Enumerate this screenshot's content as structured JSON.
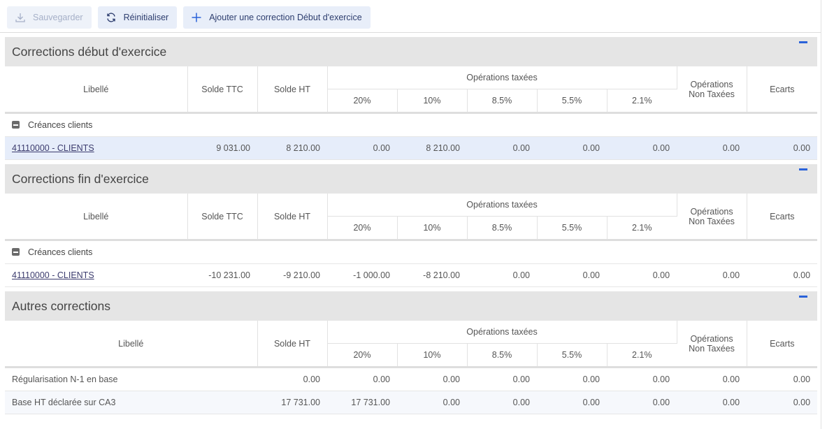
{
  "toolbar": {
    "save_label": "Sauvegarder",
    "reset_label": "Réinitialiser",
    "add_label": "Ajouter une correction Début d'exercice"
  },
  "columns": {
    "libelle": "Libellé",
    "solde_ttc": "Solde TTC",
    "solde_ht": "Solde HT",
    "operations_taxees": "Opérations taxées",
    "rates": [
      "20%",
      "10%",
      "8.5%",
      "5.5%",
      "2.1%"
    ],
    "non_taxees_line1": "Opérations",
    "non_taxees_line2": "Non Taxées",
    "ecarts": "Ecarts"
  },
  "sections": [
    {
      "title": "Corrections début d'exercice",
      "group": "Créances clients",
      "row": {
        "label": "41110000 - CLIENTS",
        "values": [
          "9 031.00",
          "8 210.00",
          "0.00",
          "8 210.00",
          "0.00",
          "0.00",
          "0.00",
          "0.00",
          "0.00"
        ]
      }
    },
    {
      "title": "Corrections fin d'exercice",
      "group": "Créances clients",
      "row": {
        "label": "41110000 - CLIENTS",
        "values": [
          "-10 231.00",
          "-9 210.00",
          "-1 000.00",
          "-8 210.00",
          "0.00",
          "0.00",
          "0.00",
          "0.00",
          "0.00"
        ]
      }
    },
    {
      "title": "Autres corrections",
      "rows": [
        {
          "label": "Régularisation N-1 en base",
          "values": [
            "0.00",
            "0.00",
            "0.00",
            "0.00",
            "0.00",
            "0.00",
            "0.00",
            "0.00"
          ]
        },
        {
          "label": "Base HT déclarée sur CA3",
          "values": [
            "17 731.00",
            "17 731.00",
            "0.00",
            "0.00",
            "0.00",
            "0.00",
            "0.00",
            "0.00"
          ]
        }
      ]
    }
  ],
  "colors": {
    "accent": "#2a62d9",
    "header_bg": "#e5e5e5",
    "selected_row": "#e6edfa"
  }
}
